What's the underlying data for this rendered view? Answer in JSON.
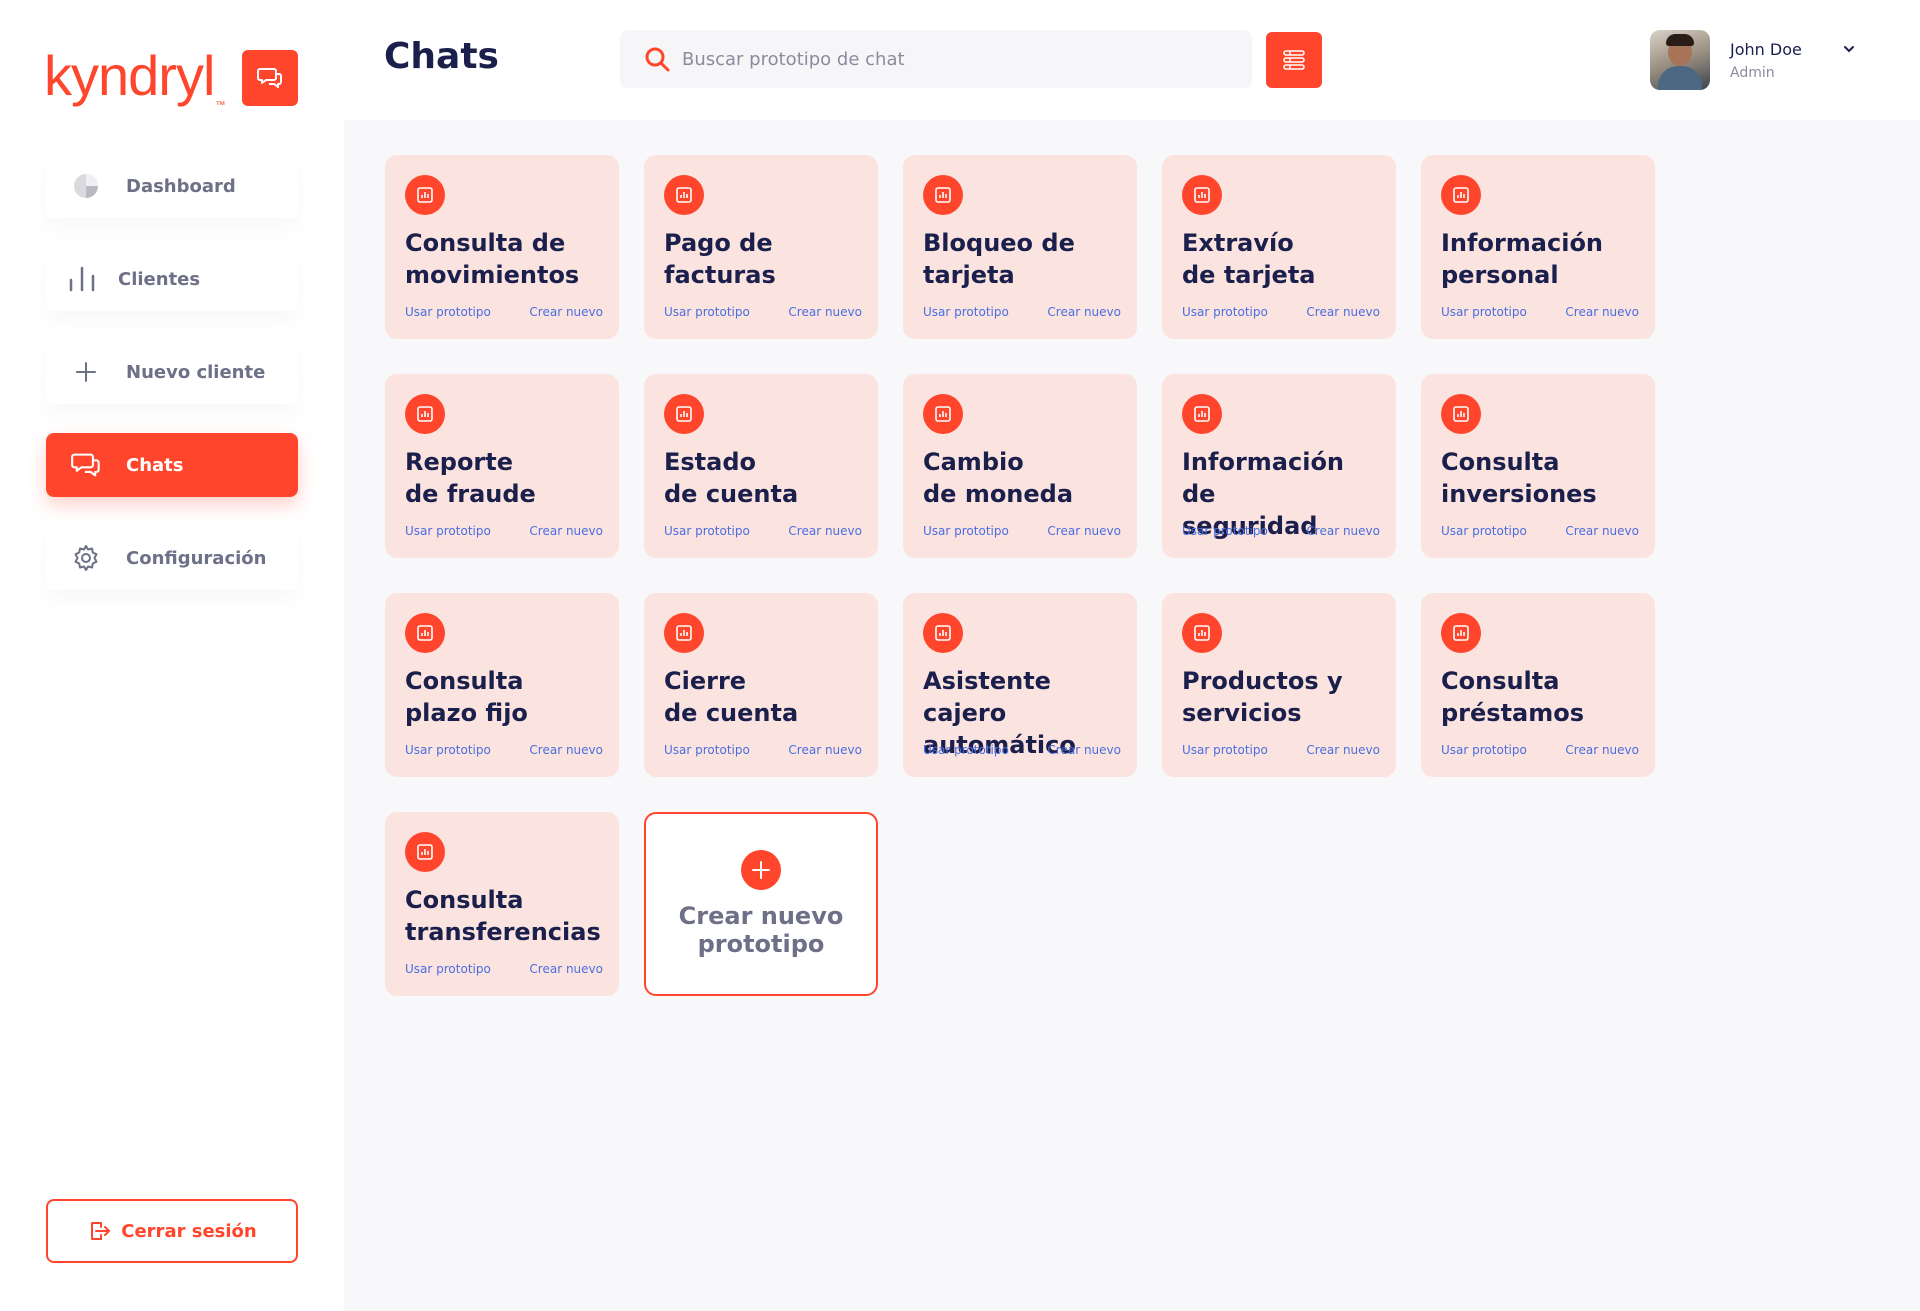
{
  "brand": {
    "logo_text": "kyndryl",
    "logo_mark": "™",
    "accent": "#ff462d"
  },
  "sidebar": {
    "items": [
      {
        "label": "Dashboard",
        "icon": "pie-chart-icon",
        "active": false
      },
      {
        "label": "Clientes",
        "icon": "bar-chart-icon",
        "active": false
      },
      {
        "label": "Nuevo cliente",
        "icon": "plus-icon",
        "active": false
      },
      {
        "label": "Chats",
        "icon": "chat-bubbles-icon",
        "active": true
      },
      {
        "label": "Configuración",
        "icon": "gear-icon",
        "active": false
      }
    ],
    "logout_label": "Cerrar sesión"
  },
  "header": {
    "title": "Chats",
    "search_placeholder": "Buscar prototipo de chat",
    "user": {
      "name": "John Doe",
      "role": "Admin"
    }
  },
  "card_links": {
    "use": "Usar prototipo",
    "create": "Crear nuevo"
  },
  "cards": [
    {
      "title": "Consulta de\nmovimientos"
    },
    {
      "title": "Pago de\nfacturas"
    },
    {
      "title": "Bloqueo de\ntarjeta"
    },
    {
      "title": "Extravío\nde tarjeta"
    },
    {
      "title": "Información\npersonal"
    },
    {
      "title": "Reporte\nde fraude"
    },
    {
      "title": "Estado\nde cuenta"
    },
    {
      "title": "Cambio\nde moneda"
    },
    {
      "title": "Información de\nseguridad"
    },
    {
      "title": "Consulta\ninversiones"
    },
    {
      "title": "Consulta\nplazo fijo"
    },
    {
      "title": "Cierre\nde cuenta"
    },
    {
      "title": "Asistente cajero\nautomático"
    },
    {
      "title": "Productos y\nservicios"
    },
    {
      "title": "Consulta\npréstamos"
    },
    {
      "title": "Consulta\ntransferencias"
    }
  ],
  "new_card": {
    "label": "Crear nuevo prototipo"
  }
}
